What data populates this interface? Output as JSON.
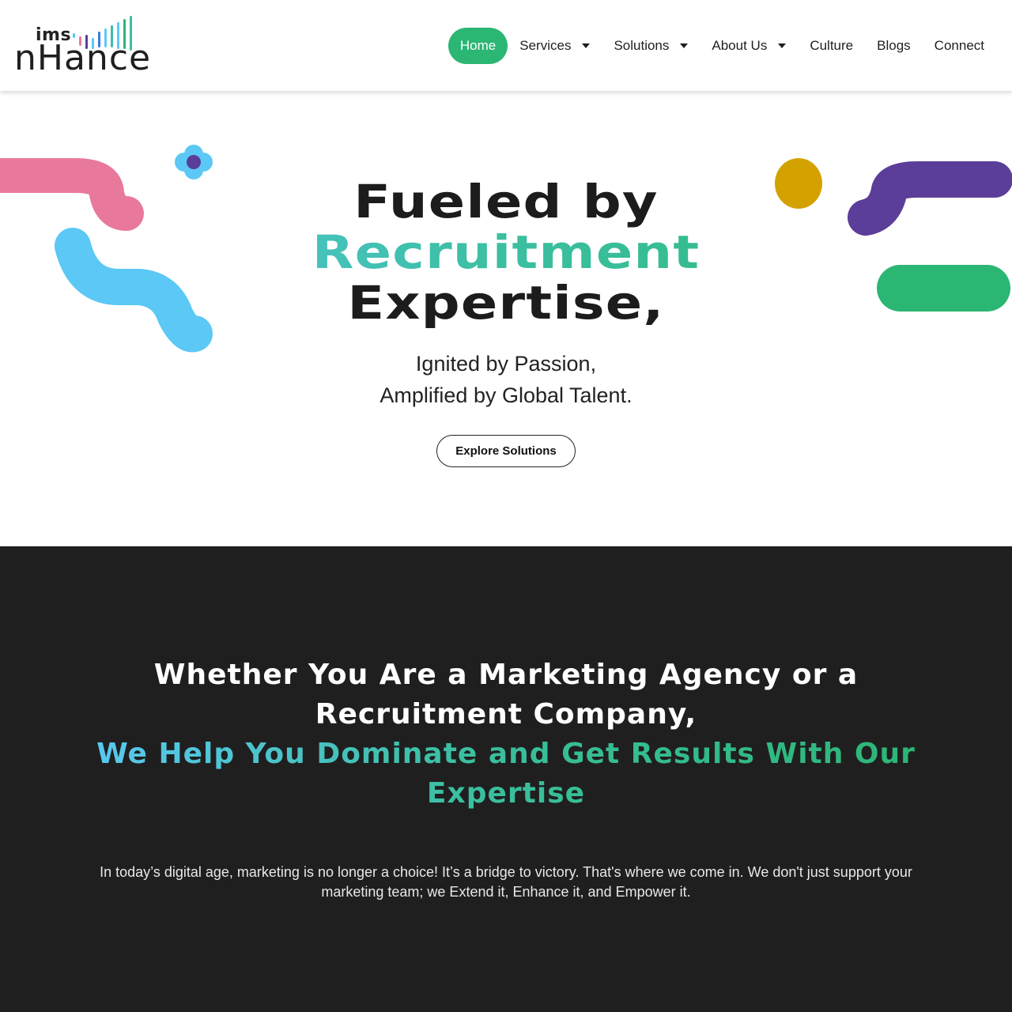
{
  "brand": {
    "logo_top": "ims",
    "logo_bottom": "nHance",
    "colors": {
      "primary_green": "#2bb673",
      "blue": "#5bc8f5",
      "purple": "#5a3e99",
      "pink": "#e8799a",
      "yellow": "#d4a200",
      "dark_bg": "#201f20"
    }
  },
  "nav": {
    "items": [
      {
        "label": "Home",
        "active": true
      },
      {
        "label": "Services",
        "dropdown": true
      },
      {
        "label": "Solutions",
        "dropdown": true
      },
      {
        "label": "About Us",
        "dropdown": true
      },
      {
        "label": "Culture"
      },
      {
        "label": "Blogs"
      },
      {
        "label": "Connect"
      }
    ]
  },
  "hero": {
    "title_line1": "Fueled by",
    "title_line2": "Recruitment",
    "title_line3": "Expertise,",
    "subtitle_line1": "Ignited by Passion,",
    "subtitle_line2": "Amplified by Global Talent.",
    "cta_label": "Explore Solutions"
  },
  "section2": {
    "heading_line1": "Whether You Are a Marketing Agency or a Recruitment Company,",
    "heading_line2": "We Help You Dominate and Get Results With Our Expertise",
    "body": "In today’s digital age, marketing is no longer a choice! It’s a bridge to victory. That's where we come in. We don't just support your marketing team; we Extend it, Enhance it, and Empower it."
  }
}
